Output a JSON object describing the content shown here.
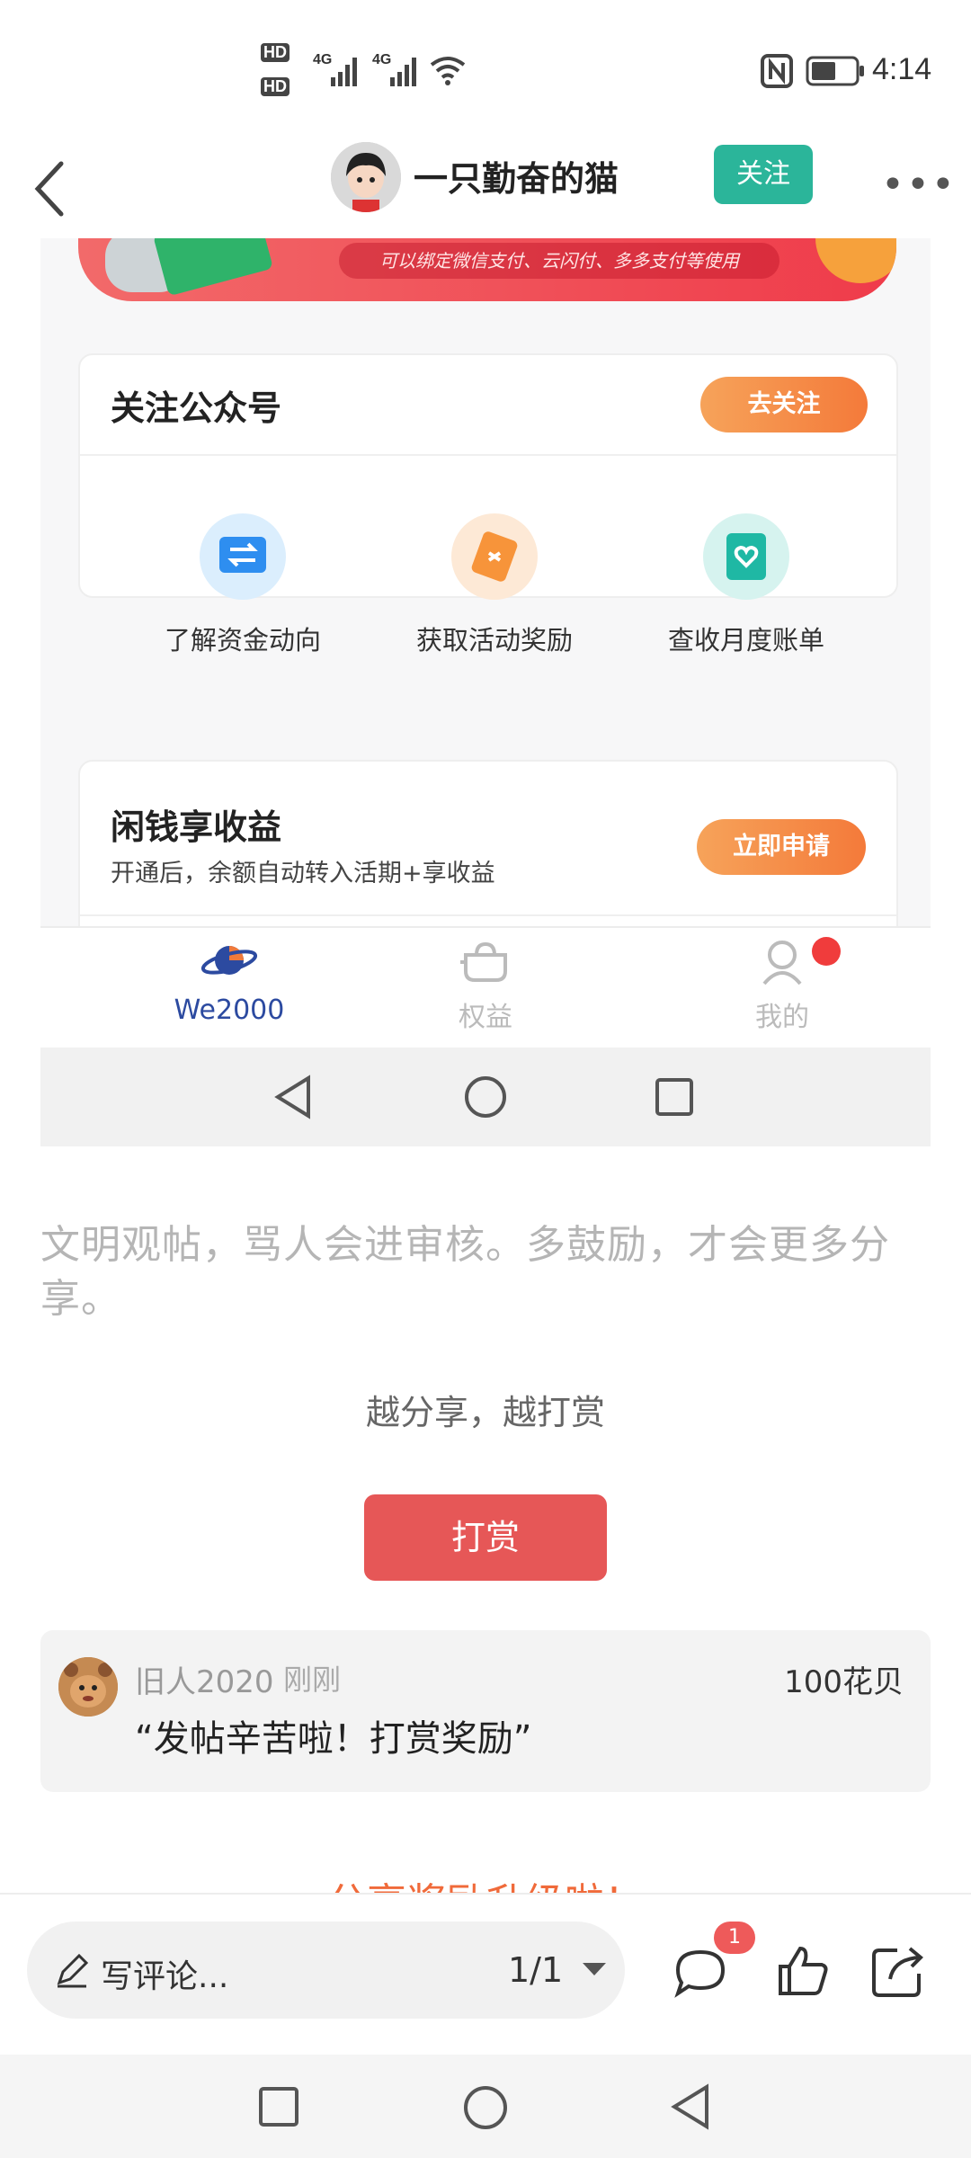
{
  "status_bar": {
    "time": "4:14",
    "hd1": "HD",
    "hd2": "HD",
    "net1": "4G",
    "net2": "4G"
  },
  "header": {
    "username": "一只勤奋的猫",
    "follow_label": "关注"
  },
  "embedded_app": {
    "banner_text": "可以绑定微信支付、云闪付、多多支付等使用",
    "follow_card": {
      "title": "关注公众号",
      "button": "去关注",
      "features": [
        {
          "label": "了解资金动向",
          "icon": "transfer-icon"
        },
        {
          "label": "获取活动奖励",
          "icon": "coupon-icon"
        },
        {
          "label": "查收月度账单",
          "icon": "heart-bill-icon"
        }
      ]
    },
    "savings_card": {
      "title": "闲钱享收益",
      "subtitle": "开通后，余额自动转入活期+享收益",
      "button": "立即申请"
    },
    "tabs": [
      {
        "label": "We2000",
        "active": true
      },
      {
        "label": "权益",
        "active": false
      },
      {
        "label": "我的",
        "active": false
      }
    ]
  },
  "content": {
    "notice": "文明观帖，骂人会进审核。多鼓励，才会更多分享。",
    "share_line": "越分享，越打赏",
    "tip_button": "打赏",
    "reward": {
      "user": "旧人2020",
      "time": "刚刚",
      "amount": "100花贝",
      "quote": "“发帖辛苦啦！打赏奖励”"
    },
    "upgrade_text": "分享奖励升级啦！"
  },
  "bottom_bar": {
    "comment_placeholder": "写评论...",
    "page_indicator": "1/1",
    "comment_count": "1"
  },
  "colors": {
    "accent_green": "#2bb59a",
    "tip_red": "#e65757",
    "orange": "#f47a3a",
    "active_tab": "#2c4aa0"
  }
}
